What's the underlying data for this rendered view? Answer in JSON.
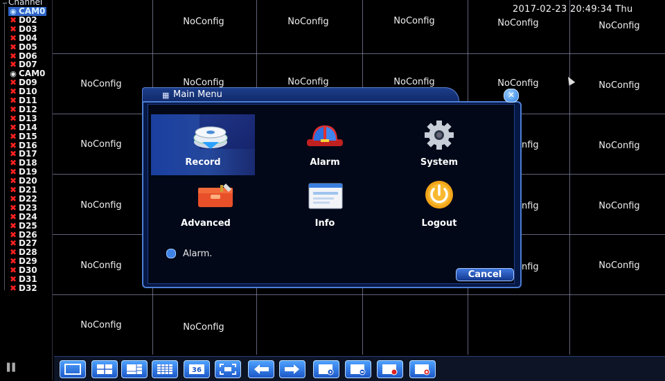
{
  "sidebar": {
    "title": "Channel",
    "channels": [
      {
        "label": "CAM0",
        "state": "on",
        "selected": true
      },
      {
        "label": "D02",
        "state": "off"
      },
      {
        "label": "D03",
        "state": "off"
      },
      {
        "label": "D04",
        "state": "off"
      },
      {
        "label": "D05",
        "state": "off"
      },
      {
        "label": "D06",
        "state": "off"
      },
      {
        "label": "D07",
        "state": "off"
      },
      {
        "label": "CAM0",
        "state": "on"
      },
      {
        "label": "D09",
        "state": "off"
      },
      {
        "label": "D10",
        "state": "off"
      },
      {
        "label": "D11",
        "state": "off"
      },
      {
        "label": "D12",
        "state": "off"
      },
      {
        "label": "D13",
        "state": "off"
      },
      {
        "label": "D14",
        "state": "off"
      },
      {
        "label": "D15",
        "state": "off"
      },
      {
        "label": "D16",
        "state": "off"
      },
      {
        "label": "D17",
        "state": "off"
      },
      {
        "label": "D18",
        "state": "off"
      },
      {
        "label": "D19",
        "state": "off"
      },
      {
        "label": "D20",
        "state": "off"
      },
      {
        "label": "D21",
        "state": "off"
      },
      {
        "label": "D22",
        "state": "off"
      },
      {
        "label": "D23",
        "state": "off"
      },
      {
        "label": "D24",
        "state": "off"
      },
      {
        "label": "D25",
        "state": "off"
      },
      {
        "label": "D26",
        "state": "off"
      },
      {
        "label": "D27",
        "state": "off"
      },
      {
        "label": "D28",
        "state": "off"
      },
      {
        "label": "D29",
        "state": "off"
      },
      {
        "label": "D30",
        "state": "off"
      },
      {
        "label": "D31",
        "state": "off"
      },
      {
        "label": "D32",
        "state": "off"
      }
    ]
  },
  "datetime": "2017-02-23 20:49:34 Thu",
  "cell_label": "NoConfig",
  "dialog": {
    "title": "Main Menu",
    "close_glyph": "✕",
    "items": [
      {
        "label": "Record",
        "icon": "record-icon",
        "selected": true
      },
      {
        "label": "Alarm",
        "icon": "alarm-icon"
      },
      {
        "label": "System",
        "icon": "system-icon"
      },
      {
        "label": "Advanced",
        "icon": "advanced-icon"
      },
      {
        "label": "Info",
        "icon": "info-icon"
      },
      {
        "label": "Logout",
        "icon": "logout-icon"
      }
    ],
    "status_text": "Alarm.",
    "cancel_label": "Cancel"
  },
  "toolbar": {
    "buttons": [
      {
        "name": "layout-1-button",
        "icon": "single-view-icon"
      },
      {
        "name": "layout-4-button",
        "icon": "quad-view-icon"
      },
      {
        "name": "layout-8-button",
        "icon": "eight-view-icon"
      },
      {
        "name": "layout-16-button",
        "icon": "sixteen-view-icon"
      },
      {
        "name": "layout-36-button",
        "icon": "thirtysix-view-icon",
        "label": "36"
      },
      {
        "name": "fullscreen-button",
        "icon": "fullscreen-icon"
      },
      {
        "name": "previous-button",
        "icon": "arrow-left-icon"
      },
      {
        "name": "next-button",
        "icon": "arrow-right-icon"
      },
      {
        "name": "playback-button",
        "icon": "playback-icon"
      },
      {
        "name": "ptz-button",
        "icon": "ptz-icon"
      },
      {
        "name": "record-start-button",
        "icon": "record-start-icon"
      },
      {
        "name": "record-stop-button",
        "icon": "record-stop-icon"
      }
    ]
  }
}
